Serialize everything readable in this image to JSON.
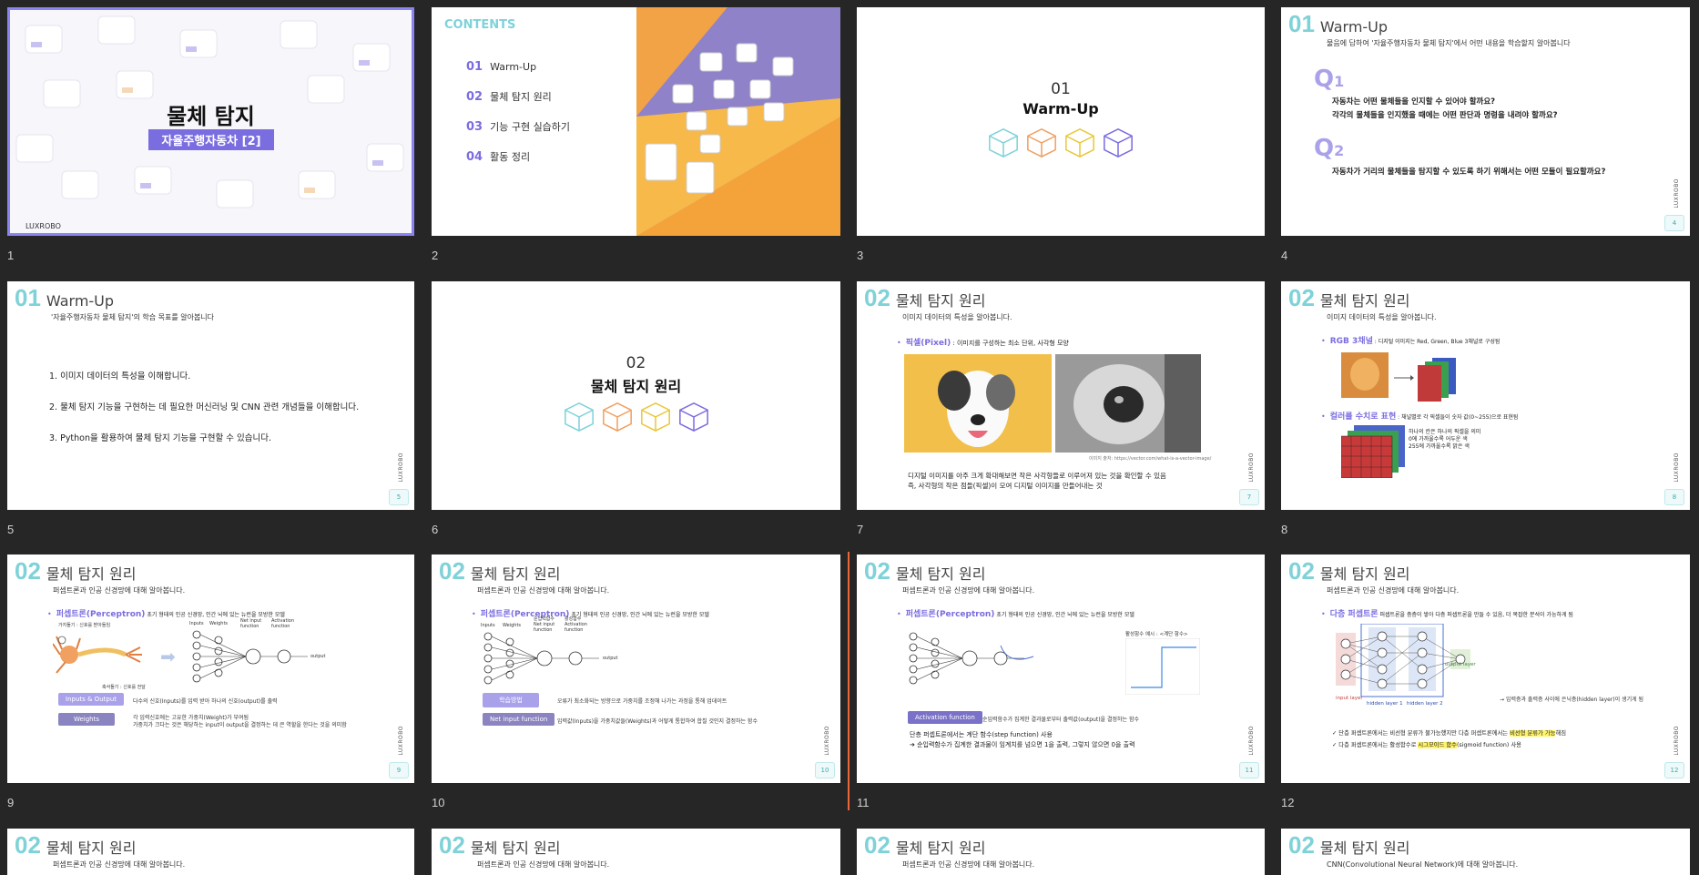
{
  "slides": [
    {
      "n": "1",
      "title": "물체 탐지",
      "subtitle": "자율주행자동차 [2]",
      "brand": "LUXROBO"
    },
    {
      "n": "2",
      "contents_label": "CONTENTS",
      "items": [
        {
          "num": "01",
          "label": "Warm-Up"
        },
        {
          "num": "02",
          "label": "물체 탐지 원리"
        },
        {
          "num": "03",
          "label": "기능 구현 실습하기"
        },
        {
          "num": "04",
          "label": "활동 정리"
        }
      ]
    },
    {
      "n": "3",
      "num": "01",
      "title": "Warm-Up"
    },
    {
      "n": "4",
      "num": "01",
      "title": "Warm-Up",
      "sub": "물음에 답하여 '자율주행자동차 물체 탐지'에서 어떤 내용을 학습할지 알아봅니다",
      "q1": "Q",
      "q1n": "1",
      "q1_lines": [
        "자동차는 어떤 물체들을 인지할 수 있어야 할까요?",
        "각각의 물체들을 인지했을 때에는 어떤 판단과 명령을 내려야 할까요?"
      ],
      "q2": "Q",
      "q2n": "2",
      "q2_line": "자동차가 거리의 물체들을 탐지할 수 있도록 하기 위해서는 어떤 모듈이 필요할까요?",
      "page": "4"
    },
    {
      "n": "5",
      "num": "01",
      "title": "Warm-Up",
      "sub": "'자율주행자동차 물체 탐지'의 학습 목표를 알아봅니다",
      "goals": [
        "1. 이미지 데이터의 특성을 이해합니다.",
        "2. 물체 탐지 기능을 구현하는 데 필요한 머신러닝 및 CNN 관련 개념들을 이해합니다.",
        "3. Python을 활용하여 물체 탐지 기능을 구현할 수 있습니다."
      ],
      "page": "5"
    },
    {
      "n": "6",
      "num": "02",
      "title": "물체 탐지 원리"
    },
    {
      "n": "7",
      "num": "02",
      "title": "물체 탐지 원리",
      "sub": "이미지 데이터의 특성을 알아봅니다.",
      "bullet_key": "픽셀(Pixel)",
      "bullet_text": " : 이미지를 구성하는 최소 단위, 사각형 모양",
      "credit": "이미지 출처: https://vector.com/what-is-a-vector-image/",
      "body": [
        "디지털 이미지를 아주 크게 확대해보면 작은 사각형들로 이루어져 있는 것을 확인할 수 있음",
        "즉, 사각형의 작은 점들(픽셀)이 모여 디지털 이미지를 만들어내는 것"
      ],
      "page": "7"
    },
    {
      "n": "8",
      "num": "02",
      "title": "물체 탐지 원리",
      "sub": "이미지 데이터의 특성을 알아봅니다.",
      "b1_key": "RGB 3채널",
      "b1_text": " : 디지털 이미지는 Red, Green, Blue 3채널로 구성됨",
      "b2_key": "컬러를 수치로 표현",
      "b2_text": " : 채널별로 각 픽셀들이 숫자 값(0~255)으로 표현됨",
      "note": [
        "하나의 칸은 하나의 픽셀을 의미",
        "0에 가까울수록 어두운 색",
        "255에 가까울수록 밝은 색"
      ],
      "page": "8"
    },
    {
      "n": "9",
      "num": "02",
      "title": "물체 탐지 원리",
      "sub": "퍼셉트론과 인공 신경망에 대해 알아봅니다.",
      "bullet_key": "퍼셉트론(Perceptron)",
      "bullet_text": " 초기 형태의 인공 신경망, 인간 뇌에 있는 뉴런을 모방한 모델",
      "labels": [
        "가지돌기 : 신호를 받아들임",
        "축삭돌기 : 신호를 전달",
        "Inputs",
        "Weights",
        "Net input function",
        "Activation function",
        "output"
      ],
      "tag1": "Inputs & Output",
      "tag1_text": "다수의 신호(Inputs)를 입력 받아 하나의 신호(output)를 출력",
      "tag2": "Weights",
      "tag2_text": [
        "각 입력신호에는 고유한 가중치(Weight)가 부여됨",
        "가중치가 크다는 것은 해당하는 input이 output을 결정하는 데 큰 역할을 한다는 것을 의미함"
      ],
      "page": "9"
    },
    {
      "n": "10",
      "num": "02",
      "title": "물체 탐지 원리",
      "sub": "퍼셉트론과 인공 신경망에 대해 알아봅니다.",
      "bullet_key": "퍼셉트론(Perceptron)",
      "bullet_text": " 초기 형태의 인공 신경망, 인간 뇌에 있는 뉴런을 모방한 모델",
      "labels": [
        "Inputs",
        "Weights",
        "순입력함수 Net input function",
        "활성함수 Activation function",
        "output"
      ],
      "tag1": "학습방법",
      "tag1_text": "오류가 최소화되는 방향으로 가중치를 조정해 나가는 과정을 통해 업데이트",
      "tag2": "Net input function",
      "tag2_text": "입력값(Inputs)을 가중치값들(Weights)과 어떻게 통합하여 합칠 것인지 결정하는 함수",
      "page": "10"
    },
    {
      "n": "11",
      "num": "02",
      "title": "물체 탐지 원리",
      "sub": "퍼셉트론과 인공 신경망에 대해 알아봅니다.",
      "bullet_key": "퍼셉트론(Perceptron)",
      "bullet_text": " 초기 형태의 인공 신경망, 인간 뇌에 있는 뉴런을 모방한 모델",
      "graph_title": "활성함수 예시 : <계단 함수>",
      "tag1": "Activation function",
      "tag1_text": "순입력함수가 집계한 결과물로부터 출력값(output)을 결정하는 함수",
      "lines": [
        "단층 퍼셉트론에서는 계단 함수(step function) 사용",
        "➔ 순입력함수가 집계한 결과물이 임계치를 넘으면 1을 출력, 그렇지 않으면 0을 출력"
      ],
      "page": "11"
    },
    {
      "n": "12",
      "num": "02",
      "title": "물체 탐지 원리",
      "sub": "퍼셉트론과 인공 신경망에 대해 알아봅니다.",
      "bullet_key": "다층 퍼셉트론",
      "bullet_text": " 퍼셉트론을 층층이 쌓아 다층 퍼셉트론을 만들 수 있음, 더 복잡한 분석이 가능하게 됨",
      "layers": [
        "input layer",
        "hidden layer 1",
        "hidden layer 2",
        "output layer"
      ],
      "hidden_note": "입력층과 출력층 사이에 은닉층(hidden layer)이 생기게 됨",
      "checks": [
        {
          "pre": "단층 퍼셉트론에서는 비선형 분류가 불가능했지만 다층 퍼셉트론에서는 ",
          "hl": "비선형 분류가 가능",
          "post": "해짐"
        },
        {
          "pre": "다층 퍼셉트론에서는 활성함수로 ",
          "hl": "시그모이드 함수",
          "post": "(sigmoid function) 사용"
        }
      ],
      "page": "12"
    },
    {
      "n": "13",
      "num": "02",
      "title": "물체 탐지 원리",
      "sub": "퍼셉트론과 인공 신경망에 대해 알아봅니다."
    },
    {
      "n": "14",
      "num": "02",
      "title": "물체 탐지 원리",
      "sub": "퍼셉트론과 인공 신경망에 대해 알아봅니다."
    },
    {
      "n": "15",
      "num": "02",
      "title": "물체 탐지 원리",
      "sub": "퍼셉트론과 인공 신경망에 대해 알아봅니다."
    },
    {
      "n": "16",
      "num": "02",
      "title": "물체 탐지 원리",
      "sub": "CNN(Convolutional Neural Network)에 대해 알아봅니다."
    }
  ],
  "brand_vertical": "LUXROBO",
  "colors": {
    "accent": "#7ed2d8",
    "purple": "#7a6de0",
    "bg": "#262626",
    "selection": "#8a84f0",
    "insert_line": "#e8683a"
  }
}
